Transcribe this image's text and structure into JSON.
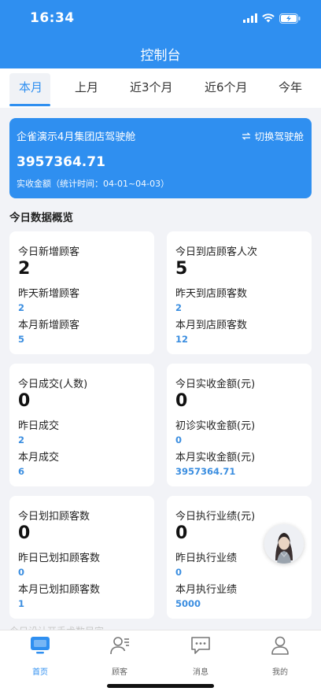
{
  "status_bar": {
    "time": "16:34"
  },
  "header": {
    "title": "控制台"
  },
  "tabs": [
    {
      "label": "本月",
      "active": true
    },
    {
      "label": "上月",
      "active": false
    },
    {
      "label": "近3个月",
      "active": false
    },
    {
      "label": "近6个月",
      "active": false
    },
    {
      "label": "今年",
      "active": false
    }
  ],
  "hero": {
    "store_name": "企雀演示4月集团店驾驶舱",
    "switch_label": "切换驾驶舱",
    "amount": "3957364.71",
    "caption": "实收金额（统计时间：04-01~04-03）"
  },
  "section_title": "今日数据概览",
  "cards": [
    {
      "title": "今日新增顾客",
      "value": "2",
      "label1": "昨天新增顾客",
      "value1": "2",
      "label2": "本月新增顾客",
      "value2": "5"
    },
    {
      "title": "今日到店顾客人次",
      "value": "5",
      "label1": "昨天到店顾客数",
      "value1": "2",
      "label2": "本月到店顾客数",
      "value2": "12"
    },
    {
      "title": "今日成交(人数)",
      "value": "0",
      "label1": "昨日成交",
      "value1": "2",
      "label2": "本月成交",
      "value2": "6"
    },
    {
      "title": "今日实收金额(元)",
      "value": "0",
      "label1": "初诊实收金额(元)",
      "value1": "0",
      "label2": "本月实收金额(元)",
      "value2": "3957364.71"
    },
    {
      "title": "今日划扣顾客数",
      "value": "0",
      "label1": "昨日已划扣顾客数",
      "value1": "0",
      "label2": "本月已划扣顾客数",
      "value2": "1"
    },
    {
      "title": "今日执行业绩(元)",
      "value": "0",
      "label1": "昨日执行业绩",
      "value1": "0",
      "label2": "本月执行业绩",
      "value2": "5000"
    }
  ],
  "faded_footer_text": "今日设计开手术数目字",
  "tabbar": [
    {
      "label": "首页",
      "icon": "monitor-icon",
      "active": true
    },
    {
      "label": "顾客",
      "icon": "customer-icon",
      "active": false
    },
    {
      "label": "消息",
      "icon": "message-icon",
      "active": false
    },
    {
      "label": "我的",
      "icon": "profile-icon",
      "active": false
    }
  ],
  "colors": {
    "primary": "#2f8ff0",
    "value_blue": "#3b8ee0",
    "background": "#f2f3f7"
  }
}
